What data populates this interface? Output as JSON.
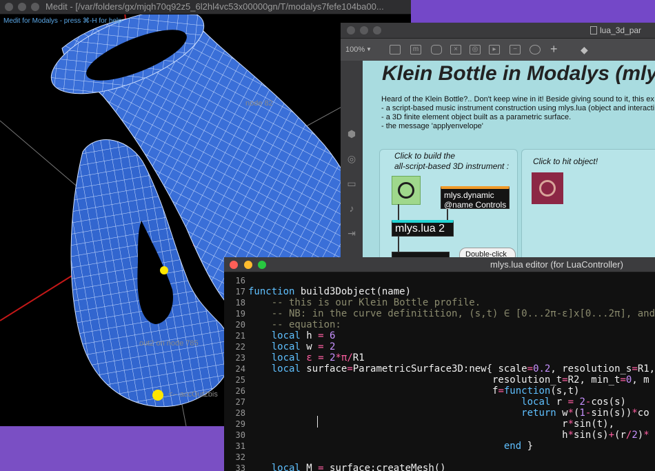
{
  "colors": {
    "background": "#6b44b8",
    "mesh": "#3a6fd8",
    "patch_bg": "#a9dce0",
    "orange_inlet": "#f19a2a",
    "cyan_inlet": "#24d4d4",
    "hit_button": "#8c2745",
    "build_button": "#9fd88c"
  },
  "medit": {
    "title": "Medit - [/var/folders/gx/mjqh70q92z5_6l2hl4vc53x00000gn/T/modalys7fefe104ba00...",
    "hint": "Medit for Modalys - press ⌘-H for help",
    "node_label_1": "node 82",
    "node_label_2": "out2 on node 785",
    "node_label_3": "<-- accOut2bis"
  },
  "patch": {
    "title": "lua_3d_par",
    "zoom": "100%",
    "heading": "Klein Bottle in Modalys (mly",
    "desc_lines": [
      "Heard of the Klein Bottle?.. Don't keep wine in it! Beside giving sound to it, this ex",
      "- a script-based music instrument construction using mlys.lua (object and interacti",
      "- a 3D finite element object built as a parametric surface.",
      "- the message 'applyenvelope'"
    ],
    "panel_build_label": "Click to build the\nall-script-based 3D instrument :",
    "panel_hit_label": "Click to hit object!",
    "dynamic_object": "mlys.dynamic\n@name Controls",
    "lua_object": "mlys.lua 2",
    "bubble": "Double-click"
  },
  "editor": {
    "title": "mlys.lua editor (for LuaController)",
    "lines": [
      {
        "n": "16",
        "html": ""
      },
      {
        "n": "17",
        "html": "<span class='kw'>function</span> build3Dobject(name)"
      },
      {
        "n": "18",
        "html": "    <span class='cm'>-- this is our Klein Bottle profile.</span>"
      },
      {
        "n": "19",
        "html": "    <span class='cm'>-- NB: in the curve definitition, (s,t) ∈ [0...2π-ε]x[0...2π], and</span>"
      },
      {
        "n": "20",
        "html": "    <span class='cm'>-- equation:</span>"
      },
      {
        "n": "21",
        "html": "    <span class='kw'>local</span> h <span class='op'>=</span> <span class='num'>6</span>"
      },
      {
        "n": "22",
        "html": "    <span class='kw'>local</span> w <span class='op'>=</span> <span class='num'>2</span>"
      },
      {
        "n": "23",
        "html": "    <span class='kw'>local</span> <span class='op'>ε</span> <span class='op'>=</span> <span class='num'>2</span><span class='op'>*π/</span>R1"
      },
      {
        "n": "24",
        "html": "    <span class='kw'>local</span> surface<span class='op'>=</span>ParametricSurface3D:new{ scale<span class='op'>=</span><span class='num'>0.2</span>, resolution_s<span class='op'>=</span>R1,"
      },
      {
        "n": "25",
        "html": "                                          resolution_t<span class='op'>=</span>R2, min_t<span class='op'>=</span><span class='num'>0</span>, m"
      },
      {
        "n": "26",
        "html": "                                          f<span class='op'>=</span><span class='kw'>function</span>(s,t)"
      },
      {
        "n": "27",
        "html": "                                               <span class='kw'>local</span> r <span class='op'>=</span> <span class='num'>2</span><span class='op'>-</span>cos(s)"
      },
      {
        "n": "28",
        "html": "                                               <span class='kw'>return</span> w<span class='op'>*</span>(<span class='num'>1</span><span class='op'>-</span>sin(s))<span class='op'>*</span>co"
      },
      {
        "n": "29",
        "html": "                                                      r<span class='op'>*</span>sin(t),"
      },
      {
        "n": "30",
        "html": "                                                      h<span class='op'>*</span>sin(s)<span class='op'>+</span>(r<span class='op'>/</span><span class='num'>2</span>)<span class='op'>*</span>"
      },
      {
        "n": "31",
        "html": "                                            <span class='kw'>end</span> }"
      },
      {
        "n": "32",
        "html": ""
      },
      {
        "n": "33",
        "html": "    <span class='kw'>local</span> M <span class='op'>=</span> surface:createMesh()"
      }
    ]
  }
}
